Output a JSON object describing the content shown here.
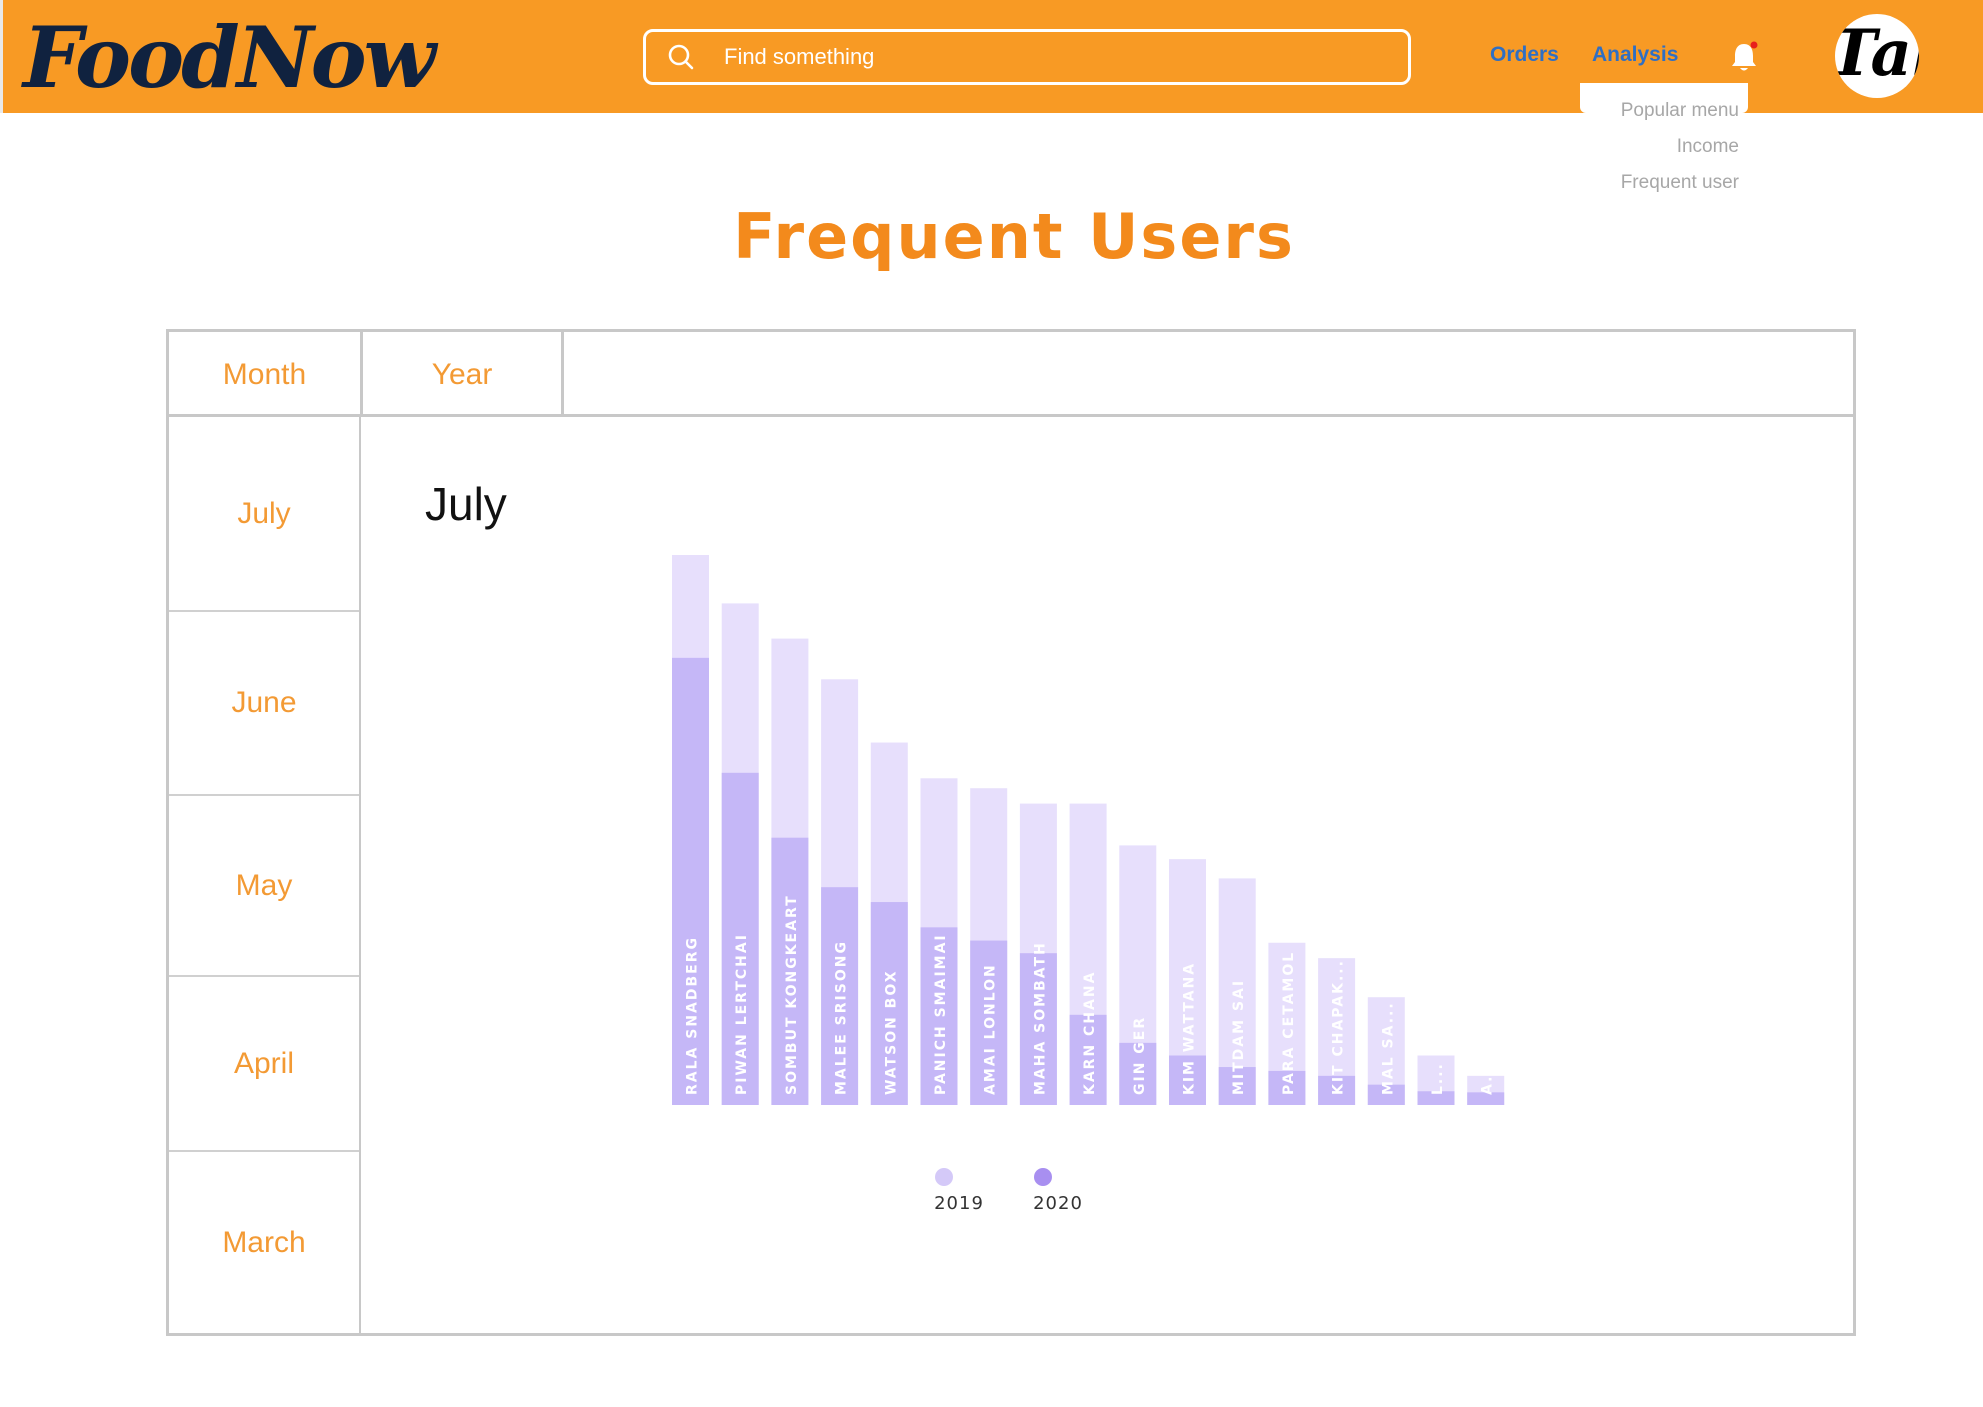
{
  "header": {
    "logo_text": "FoodNow",
    "search_placeholder": "Find something",
    "nav": {
      "orders": "Orders",
      "analysis": "Analysis"
    },
    "avatar_text": "Tal",
    "brand_color": "#f89a24",
    "notification_dot_color": "#e8201c"
  },
  "analysis_menu": {
    "items": [
      "Popular menu",
      "Income",
      "Frequent user"
    ]
  },
  "page": {
    "title": "Frequent Users"
  },
  "filters": {
    "tabs": [
      "Month",
      "Year"
    ],
    "months": [
      "July",
      "June",
      "May",
      "April",
      "March"
    ]
  },
  "chart_data": {
    "type": "bar",
    "title": "July",
    "stacked": false,
    "categories": [
      "RALA SNADBERG",
      "PIWAN LERTCHAI",
      "SOMBUT KONGKEART",
      "MALEE SRISONG",
      "WATSON BOX",
      "PANICH SMAIMAI",
      "AMAI LONLON",
      "MAHA SOMBATH",
      "KARN CHANA",
      "GIN GER",
      "KIM WATTANA",
      "MITDAM SAI",
      "PARA CETAMOL",
      "KIT CHAPAK...",
      "MAL SA...",
      "L...",
      "A..."
    ],
    "series": [
      {
        "name": "2019",
        "color": "#e7dffc",
        "values": [
          100,
          91.2,
          84.8,
          77.4,
          65.9,
          59.4,
          57.6,
          54.8,
          54.8,
          47.2,
          44.7,
          41.2,
          29.5,
          26.7,
          19.6,
          9.0,
          5.3
        ]
      },
      {
        "name": "2020",
        "color": "#c5b7f7",
        "values": [
          81.3,
          60.4,
          48.6,
          39.6,
          36.9,
          32.3,
          29.9,
          27.6,
          16.4,
          11.3,
          9.0,
          6.9,
          6.2,
          5.3,
          3.7,
          2.5,
          2.3
        ]
      }
    ],
    "legend_marker_colors": [
      "#d4c9f8",
      "#a88ff0"
    ],
    "ylim": [
      0,
      100
    ],
    "grid": false,
    "legend": "bottom"
  }
}
